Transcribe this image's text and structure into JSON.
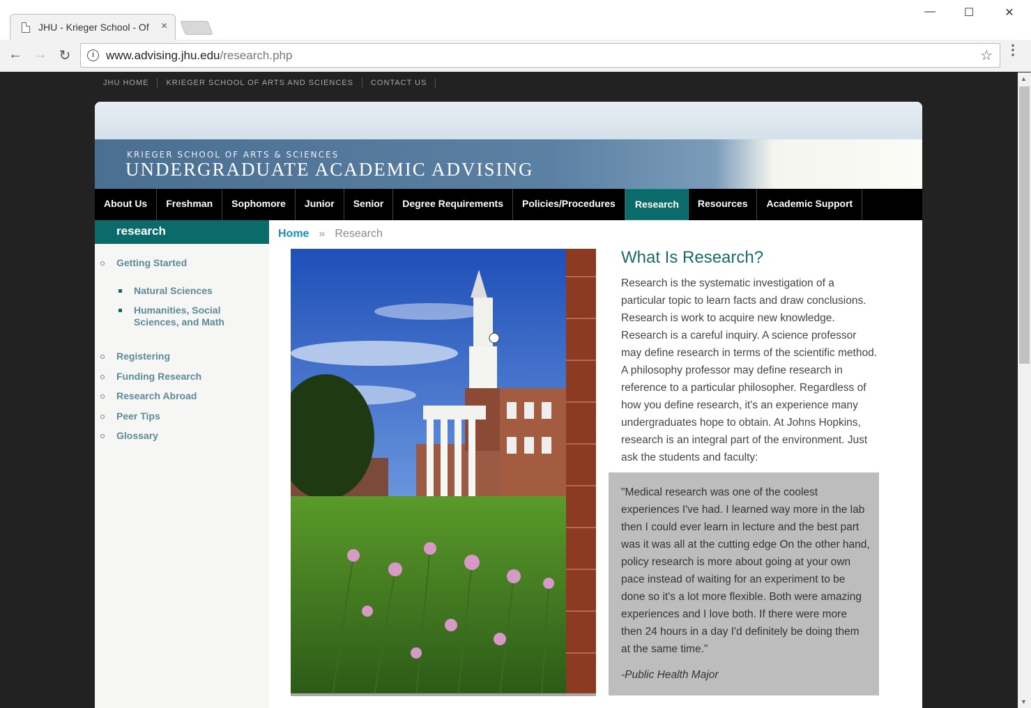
{
  "browser": {
    "tab_title": "JHU - Krieger School - Of",
    "tab_close": "×",
    "url_domain": "www.advising.jhu.edu",
    "url_path": "/research.php",
    "info_glyph": "i",
    "star_glyph": "☆",
    "back_glyph": "←",
    "forward_glyph": "→",
    "reload_glyph": "↻",
    "minimize_glyph": "—",
    "maximize_glyph": "☐",
    "close_glyph": "✕",
    "menu_glyph": "⋮"
  },
  "utility_nav": [
    "JHU HOME",
    "KRIEGER SCHOOL OF ARTS AND SCIENCES",
    "CONTACT US"
  ],
  "banner": {
    "school": "KRIEGER SCHOOL OF ARTS & SCIENCES",
    "title": "UNDERGRADUATE ACADEMIC ADVISING"
  },
  "main_nav": [
    {
      "label": "About Us"
    },
    {
      "label": "Freshman"
    },
    {
      "label": "Sophomore"
    },
    {
      "label": "Junior"
    },
    {
      "label": "Senior"
    },
    {
      "label": "Degree Requirements"
    },
    {
      "label": "Policies/Procedures"
    },
    {
      "label": "Research",
      "active": true
    },
    {
      "label": "Resources"
    },
    {
      "label": "Academic Support"
    }
  ],
  "sidebar": {
    "heading": "research",
    "items": [
      {
        "label": "Getting Started",
        "level": 1
      },
      {
        "label": "Natural Sciences",
        "level": 2
      },
      {
        "label": "Humanities, Social Sciences, and Math",
        "level": 2
      },
      {
        "label": "Registering",
        "level": 1
      },
      {
        "label": "Funding Research",
        "level": 1
      },
      {
        "label": "Research Abroad",
        "level": 1
      },
      {
        "label": "Peer Tips",
        "level": 1
      },
      {
        "label": "Glossary",
        "level": 1
      }
    ]
  },
  "breadcrumb": {
    "home": "Home",
    "separator": "»",
    "current": "Research"
  },
  "article": {
    "heading": "What Is Research?",
    "body": "Research is the systematic investigation of a particular topic to learn facts and draw conclusions. Research is work to acquire new knowledge. Research is a careful inquiry. A science professor may define research in terms of the scientific method. A philosophy professor may define research in reference to a particular philosopher. Regardless of how you define research, it's an experience many undergraduates hope to obtain. At Johns Hopkins, research is an integral part of the environment. Just ask the students and faculty:"
  },
  "quote": {
    "text": "\"Medical research was one of the coolest experiences I've had. I learned way more in the lab then I could ever learn in lecture and the best part was it was all at the cutting edge On the other hand, policy research is more about going at your own pace instead of waiting for an experiment to be done so it's a lot more flexible. Both were amazing experiences and I love both. If there were more then 24 hours in a day I'd definitely be doing them at the same time.\"",
    "attribution": "-Public Health Major"
  },
  "colors": {
    "teal": "#0b6b6b",
    "link": "#1a8fb8",
    "sidebar_link": "#5c8a99",
    "nav_bg": "#000000",
    "quote_bg": "#bdbdbd"
  }
}
